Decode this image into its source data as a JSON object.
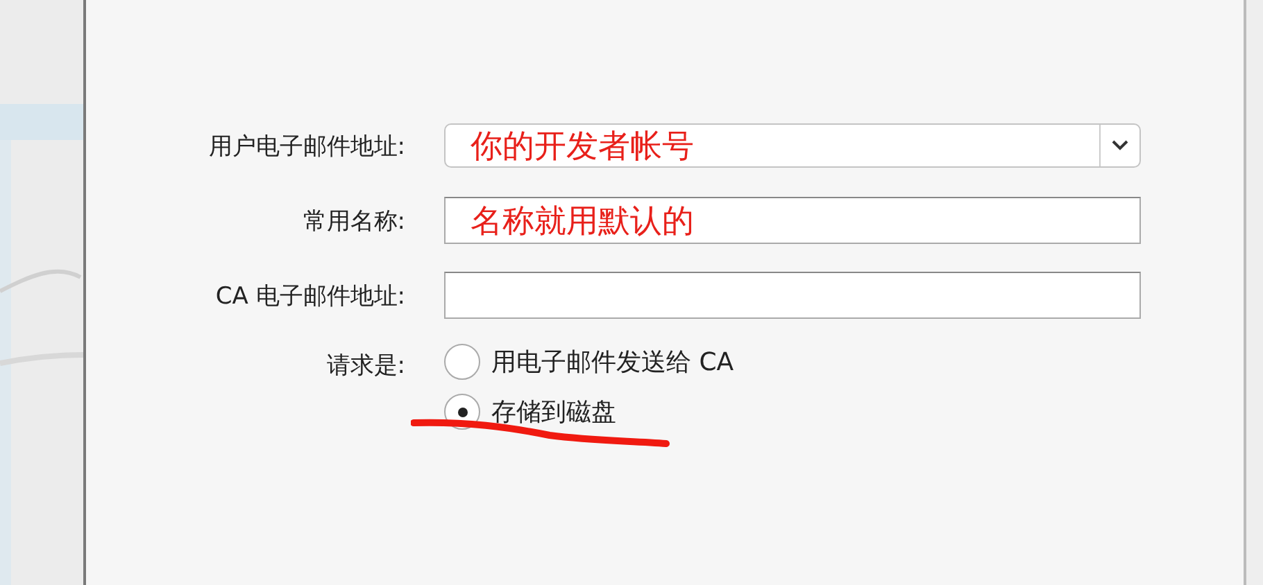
{
  "fields": [
    {
      "label": "用户电子邮件地址:",
      "kind": "combo",
      "annotation": "你的开发者帐号"
    },
    {
      "label": "常用名称:",
      "kind": "text",
      "annotation": "名称就用默认的"
    },
    {
      "label": "CA 电子邮件地址:",
      "kind": "text"
    }
  ],
  "request": {
    "label": "请求是:",
    "options": [
      {
        "label": "用电子邮件发送给 CA",
        "selected": false
      },
      {
        "label": "存储到磁盘",
        "selected": true
      }
    ]
  },
  "underline_mark": {
    "kind": "stroke"
  }
}
